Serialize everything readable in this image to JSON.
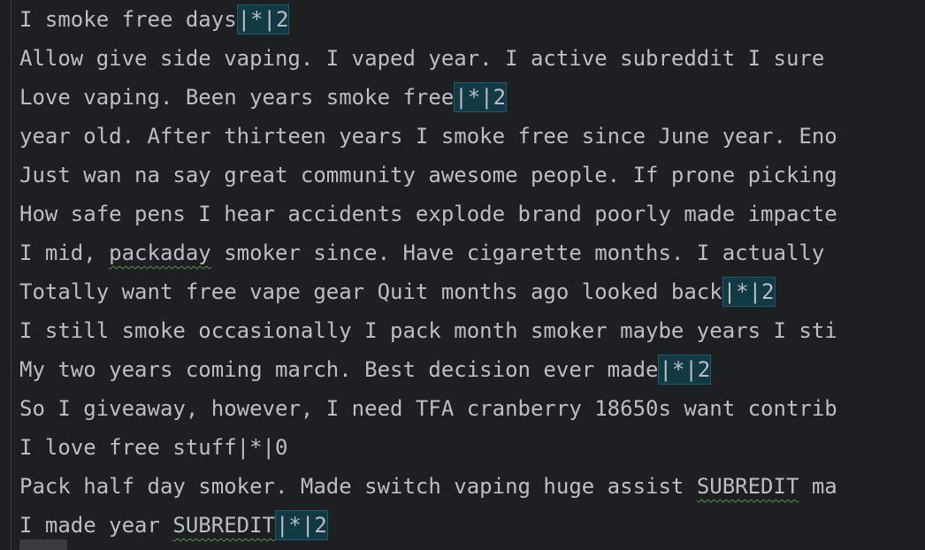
{
  "lines": [
    [
      "I smoke free days",
      "|*|2"
    ],
    [
      "Allow give side vaping. I vaped year. I active subreddit I sure",
      ""
    ],
    [
      "Love vaping. Been years smoke free",
      "|*|2"
    ],
    [
      "year old. After thirteen years I smoke free since June year. Eno",
      ""
    ],
    [
      "Just wan na say great community awesome people. If prone picking",
      ""
    ],
    [
      "How safe pens I hear accidents explode brand poorly made impacte",
      ""
    ],
    [
      "I mid, ",
      "packaday",
      " smoker since. Have cigarette months. I actually "
    ],
    [
      "Totally want free vape gear Quit months ago looked back",
      "|*|2"
    ],
    [
      "I still smoke occasionally I pack month smoker maybe years I sti",
      ""
    ],
    [
      "My two years coming march. Best decision ever made",
      "|*|2"
    ],
    [
      "So I giveaway, however, I need TFA cranberry 18650s want contrib",
      ""
    ],
    [
      "I love free stuff|*|0",
      ""
    ],
    [
      "Pack half day smoker. Made switch vaping huge assist ",
      "SUBREDIT",
      " ma"
    ],
    [
      "I made year ",
      "SUBREDIT",
      "|*|2"
    ]
  ]
}
